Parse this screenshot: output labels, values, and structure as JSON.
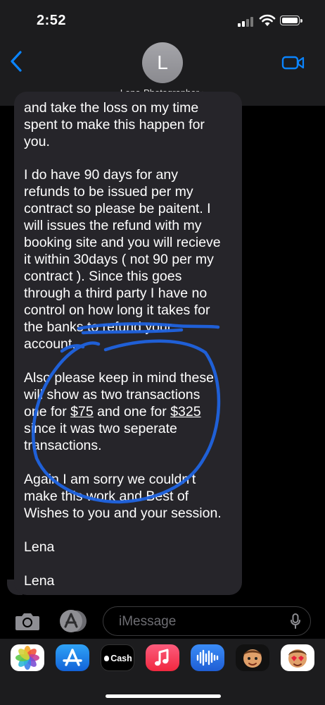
{
  "status_bar": {
    "time": "2:52"
  },
  "header": {
    "avatar_initial": "L",
    "contact_name": "Lena-Photographer",
    "chevron": "›"
  },
  "message": {
    "lines_p1": [
      "and take the loss on my time",
      "spent to make this happen for",
      "you."
    ],
    "lines_p2": [
      "I do  have 90 days for any",
      "refunds to be issued per my",
      "contract so please be paitent.  I",
      "will issues the refund with my",
      "booking site and you will recieve",
      "it within 30days ( not 90 per my",
      "contract ). Since this goes",
      "through a third party I have no",
      "control on how long it takes for",
      "the banks to refund your",
      "account."
    ],
    "p3_line1": "Also please keep in mind these",
    "p3_line2": "will show as two transactions",
    "p3_line3_pre": "one for ",
    "p3_amount1": "$75",
    "p3_line3_mid": " and one for ",
    "p3_amount2": "$325",
    "p3_line4": "since it was two seperate",
    "p3_line5": "transactions.",
    "lines_p4": [
      "Again I am sorry we couldn't",
      "make this work and Best of",
      "Wishes to you and your session."
    ],
    "signoff1": "Lena",
    "signoff2": "Lena"
  },
  "compose": {
    "placeholder": "iMessage"
  },
  "app_drawer": {
    "items": [
      {
        "icon": "photos-icon"
      },
      {
        "icon": "app-store-icon"
      },
      {
        "icon": "apple-cash-icon",
        "label": "Cash"
      },
      {
        "icon": "music-icon"
      },
      {
        "icon": "audio-message-icon"
      },
      {
        "icon": "memoji-icon"
      },
      {
        "icon": "memoji-stickers-icon"
      }
    ]
  },
  "colors": {
    "accent": "#0a84ff",
    "bubble": "#26252a",
    "header": "#1c1c1e",
    "scribble": "#1f63e0"
  }
}
